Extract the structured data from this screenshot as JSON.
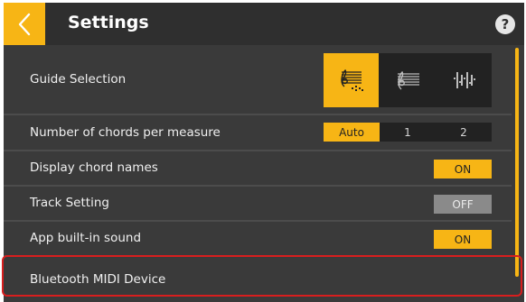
{
  "header": {
    "title": "Settings",
    "back_icon": "chevron-left-icon",
    "help_label": "?"
  },
  "rows": {
    "guide_selection": {
      "label": "Guide Selection",
      "options": [
        "staff-chords-icon",
        "staff-icon",
        "chord-diagram-icon"
      ],
      "selected_index": 0
    },
    "chords_per_measure": {
      "label": "Number of chords per measure",
      "options": [
        "Auto",
        "1",
        "2"
      ],
      "selected": "Auto"
    },
    "display_chord_names": {
      "label": "Display chord names",
      "state": "ON"
    },
    "track_setting": {
      "label": "Track Setting",
      "state": "OFF"
    },
    "app_builtin_sound": {
      "label": "App built-in sound",
      "state": "ON"
    },
    "bluetooth_midi": {
      "label": "Bluetooth MIDI Device"
    }
  },
  "colors": {
    "accent": "#f7b515",
    "background": "#3a3a3a",
    "header": "#2f2f2f",
    "highlight": "#d81e1e"
  }
}
